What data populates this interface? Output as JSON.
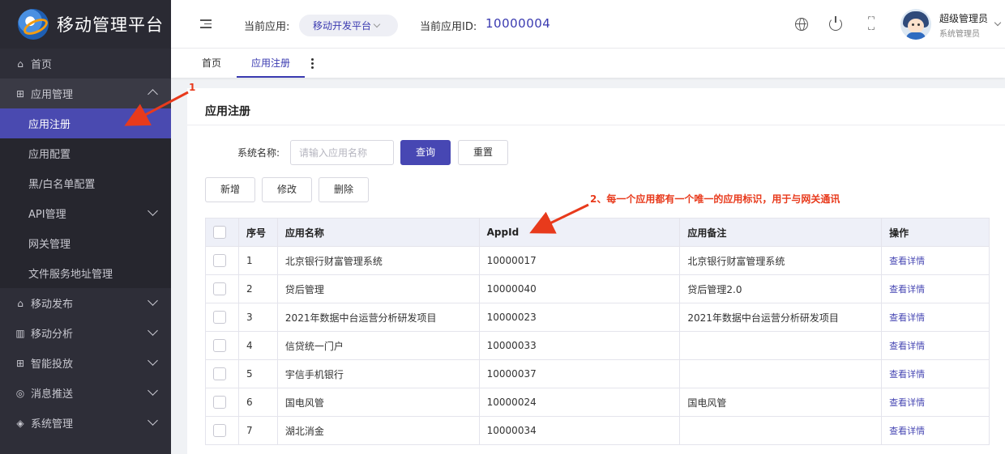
{
  "brand": {
    "title": "移动管理平台"
  },
  "sidebar": {
    "items": [
      {
        "label": "首页",
        "icon": "home-icon",
        "glyph": "⌂"
      },
      {
        "label": "应用管理",
        "icon": "grid-icon",
        "glyph": "⊞"
      },
      {
        "label": "应用注册"
      },
      {
        "label": "应用配置"
      },
      {
        "label": "黑/白名单配置"
      },
      {
        "label": "API管理"
      },
      {
        "label": "网关管理"
      },
      {
        "label": "文件服务地址管理"
      },
      {
        "label": "移动发布",
        "icon": "publish-icon",
        "glyph": "⌂"
      },
      {
        "label": "移动分析",
        "icon": "chart-icon",
        "glyph": "▥"
      },
      {
        "label": "智能投放",
        "icon": "grid-icon",
        "glyph": "⊞"
      },
      {
        "label": "消息推送",
        "icon": "message-icon",
        "glyph": "◎"
      },
      {
        "label": "系统管理",
        "icon": "layers-icon",
        "glyph": "◈"
      }
    ]
  },
  "header": {
    "current_app_label": "当前应用:",
    "current_app_value": "移动开发平台",
    "current_app_id_label": "当前应用ID:",
    "current_app_id_value": "10000004",
    "user_name": "超级管理员",
    "user_role": "系统管理员"
  },
  "tabs": [
    {
      "label": "首页"
    },
    {
      "label": "应用注册"
    }
  ],
  "page": {
    "title": "应用注册",
    "search_label": "系统名称:",
    "search_placeholder": "请输入应用名称",
    "query_label": "查询",
    "reset_label": "重置",
    "add_label": "新增",
    "edit_label": "修改",
    "delete_label": "删除"
  },
  "table": {
    "headers": [
      "序号",
      "应用名称",
      "AppId",
      "应用备注",
      "操作"
    ],
    "rows": [
      {
        "no": "1",
        "name": "北京银行财富管理系统",
        "appid": "10000017",
        "remark": "北京银行财富管理系统",
        "action": "查看详情"
      },
      {
        "no": "2",
        "name": "贷后管理",
        "appid": "10000040",
        "remark": "贷后管理2.0",
        "action": "查看详情"
      },
      {
        "no": "3",
        "name": "2021年数据中台运营分析研发项目",
        "appid": "10000023",
        "remark": "2021年数据中台运营分析研发项目",
        "action": "查看详情"
      },
      {
        "no": "4",
        "name": "信贷统一门户",
        "appid": "10000033",
        "remark": "",
        "action": "查看详情"
      },
      {
        "no": "5",
        "name": "宇信手机银行",
        "appid": "10000037",
        "remark": "",
        "action": "查看详情"
      },
      {
        "no": "6",
        "name": "国电风管",
        "appid": "10000024",
        "remark": "国电风管",
        "action": "查看详情"
      },
      {
        "no": "7",
        "name": "湖北消金",
        "appid": "10000034",
        "remark": "",
        "action": "查看详情"
      }
    ]
  },
  "annotations": {
    "a1": "1",
    "a2": "2、每一个应用都有一个唯一的应用标识，用于与网关通讯"
  },
  "colors": {
    "accent": "#4747b3",
    "sidebar": "#2e2e38",
    "annotation": "#e83a1c"
  }
}
